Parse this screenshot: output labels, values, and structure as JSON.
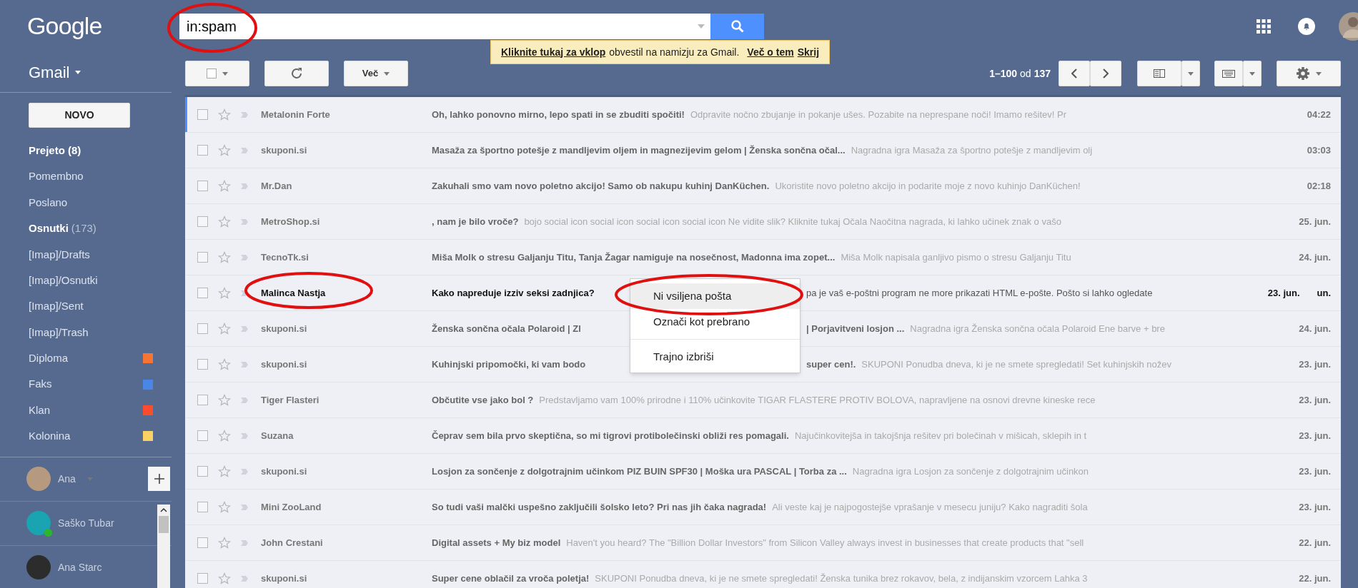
{
  "header": {
    "logo": "Google",
    "search": {
      "value": "in:spam"
    }
  },
  "banner": {
    "link": "Kliknite tukaj za vklop",
    "text": "obvestil na namizju za Gmail.",
    "more": "Več o tem",
    "hide": "Skrij"
  },
  "sidebar": {
    "app": "Gmail",
    "compose": "NOVO",
    "items": [
      {
        "label": "Prejeto (8)",
        "bold": true
      },
      {
        "label": "Pomembno",
        "bold": false
      },
      {
        "label": "Poslano",
        "bold": false
      },
      {
        "label": "Osnutki",
        "count": "(173)",
        "bold": true
      },
      {
        "label": "[Imap]/Drafts",
        "bold": false
      },
      {
        "label": "[Imap]/Osnutki",
        "bold": false
      },
      {
        "label": "[Imap]/Sent",
        "bold": false
      },
      {
        "label": "[Imap]/Trash",
        "bold": false
      },
      {
        "label": "Diploma",
        "bold": false,
        "color": "#f87433"
      },
      {
        "label": "Faks",
        "bold": false,
        "color": "#4a86e8"
      },
      {
        "label": "Klan",
        "bold": false,
        "color": "#fb4c2f"
      },
      {
        "label": "Kolonina",
        "bold": false,
        "color": "#fad165"
      }
    ],
    "chat": [
      {
        "name": "Ana",
        "color": "#b59a80",
        "online": false
      },
      {
        "name": "Saško Tubar",
        "color": "#1aa3b0",
        "online": true
      },
      {
        "name": "Ana Starc",
        "color": "#2c2c2c",
        "online": false
      }
    ]
  },
  "toolbar": {
    "more": "Več",
    "range": "1–100",
    "of": "od",
    "total": "137"
  },
  "rows": [
    {
      "kind": "plain",
      "checked": false,
      "sender": "Metalonin Forte",
      "subject": "Oh, lahko ponovno mirno, lepo spati in se zbuditi spočiti!",
      "snippet": "Odpravite nočno zbujanje in pokanje ušes. Pozabite na neprespane noči! Imamo rešitev! Pr",
      "date": "04:22",
      "focused": true
    },
    {
      "kind": "plain",
      "checked": false,
      "sender": "skuponi.si",
      "subject": "Masaža za športno potešje z mandljevim oljem in magnezijevim gelom | Ženska sončna očal...",
      "snippet": "Nagradna igra Masaža za športno potešje z mandljevim olj",
      "date": "03:03",
      "focused": false
    },
    {
      "kind": "plain",
      "checked": false,
      "sender": "Mr.Dan",
      "subject": "Zakuhali smo vam novo poletno akcijo! Samo ob nakupu kuhinj DanKüchen.",
      "snippet": "Ukoristite novo poletno akcijo in podarite moje z novo kuhinjo DanKüchen!",
      "date": "02:18",
      "focused": false
    },
    {
      "kind": "plain",
      "checked": false,
      "sender": "MetroShop.si",
      "subject": ", nam je bilo vroče?",
      "snippet": "bojo social icon social icon social icon social icon Ne vidite slik? Kliknite tukaj Očala Naočitna nagrada, ki lahko učinek znak o vašo",
      "date": "25. jun.",
      "focused": false
    },
    {
      "kind": "plain",
      "checked": false,
      "sender": "TecnoTk.si",
      "subject": "Miša Molk o stresu Galjanju Titu, Tanja Žagar namiguje na nosečnost, Madonna ima zopet...",
      "snippet": "Miša Molk napisala ganljivo pismo o stresu Galjanju Titu",
      "date": "24. jun.",
      "focused": false
    },
    {
      "kind": "covered",
      "checked": false,
      "sender": "Malinca Nastja",
      "subject": "Kako napreduje izziv seksi zadnjica?",
      "rest_snippet": "pa je vaš e-poštni program ne more prikazati HTML e-pošte. Pošto si lahko ogledate",
      "date": "23. jun.",
      "date_extra": "un.",
      "focused": false
    },
    {
      "kind": "covered",
      "checked": false,
      "sender": "skuponi.si",
      "subject": "Ženska sončna očala Polaroid | Zl",
      "rest_subject": "| Porjavitveni losjon ...",
      "rest_snippet": "Nagradna igra Ženska sončna očala Polaroid Ene barve + bre",
      "date": "24. jun.",
      "focused": false
    },
    {
      "kind": "covered",
      "checked": false,
      "sender": "skuponi.si",
      "subject": "Kuhinjski pripomočki, ki vam bodo",
      "rest_subject": "super cen!.",
      "rest_snippet": "SKUPONI Ponudba dneva, ki je ne smete spregledati! Set kuhinjskih nožev",
      "date": "23. jun.",
      "focused": false
    },
    {
      "kind": "plain",
      "checked": false,
      "sender": "Tiger Flasteri",
      "subject": "Občutite vse jako bol ?",
      "snippet": "Predstavljamo vam 100% prirodne i 110% učinkovite TIGAR FLASTERE PROTIV BOLOVA, napravljene na osnovi drevne kineske rece",
      "date": "23. jun.",
      "focused": false
    },
    {
      "kind": "plain",
      "checked": false,
      "sender": "Suzana",
      "subject": "Čeprav sem bila prvo skeptična, so mi tigrovi protibolečinski obliži res pomagali.",
      "snippet": "Najučinkovitejša in takojšnja rešitev pri bolečinah v mišicah, sklepih in t",
      "date": "23. jun.",
      "focused": false
    },
    {
      "kind": "plain",
      "checked": false,
      "sender": "skuponi.si",
      "subject": "Losjon za sončenje z dolgotrajnim učinkom PIZ BUIN SPF30 | Moška ura PASCAL | Torba za ...",
      "snippet": "Nagradna igra Losjon za sončenje z dolgotrajnim učinkon",
      "date": "23. jun.",
      "focused": false
    },
    {
      "kind": "plain",
      "checked": false,
      "sender": "Mini ZooLand",
      "subject": "So tudi vaši malčki uspešno zaključili šolsko leto? Pri nas jih čaka nagrada!",
      "snippet": "Ali veste kaj je najpogostejše vprašanje v mesecu juniju? Kako nagraditi šola",
      "date": "23. jun.",
      "focused": false
    },
    {
      "kind": "plain",
      "checked": false,
      "sender": "John Crestani",
      "subject": "Digital assets + My biz model",
      "snippet": "Haven't you heard? The \"Billion Dollar Investors\" from Silicon Valley always invest in businesses that create products that \"sell",
      "date": "22. jun.",
      "focused": false
    },
    {
      "kind": "plain",
      "checked": false,
      "sender": "skuponi.si",
      "subject": "Super cene oblačil za vroča poletja!",
      "snippet": "SKUPONI Ponudba dneva, ki je ne smete spregledati! Ženska tunika brez rokavov, bela, z indijanskim vzorcem Lahka 3",
      "date": "22. jun.",
      "focused": false
    }
  ],
  "context_menu": {
    "items": [
      {
        "label": "Ni vsiljena pošta",
        "selected": true
      },
      {
        "label": "Označi kot prebrano",
        "selected": false
      },
      {
        "label": "Trajno izbriši",
        "selected": false
      }
    ]
  }
}
